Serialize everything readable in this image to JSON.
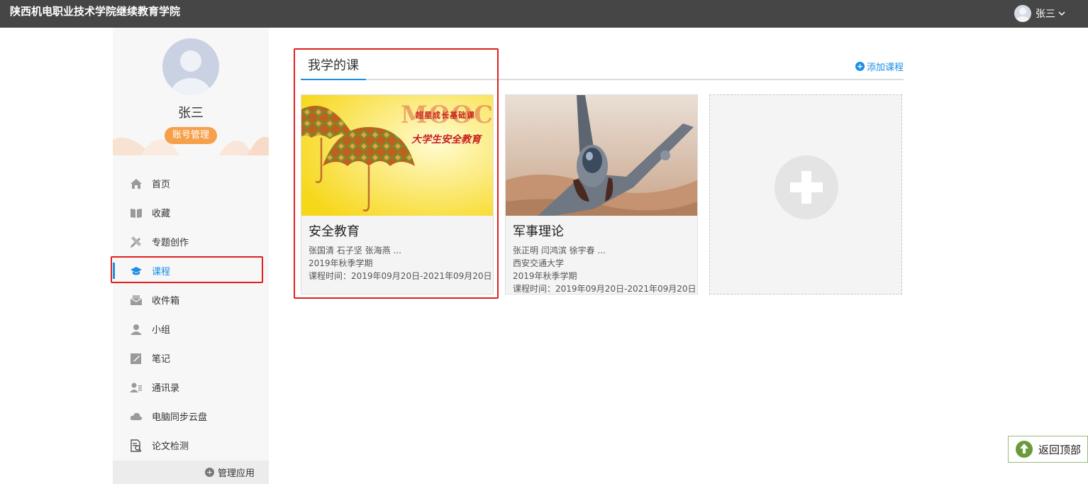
{
  "header": {
    "site_title": "陕西机电职业技术学院继续教育学院",
    "user_name": "张三"
  },
  "profile": {
    "name": "张三",
    "account_button": "账号管理"
  },
  "sidebar": {
    "items": [
      {
        "label": "首页",
        "icon": "home-icon"
      },
      {
        "label": "收藏",
        "icon": "book-icon"
      },
      {
        "label": "专题创作",
        "icon": "pencil-ruler-icon"
      },
      {
        "label": "课程",
        "icon": "graduation-cap-icon",
        "active": true
      },
      {
        "label": "收件箱",
        "icon": "inbox-icon"
      },
      {
        "label": "小组",
        "icon": "person-icon"
      },
      {
        "label": "笔记",
        "icon": "note-icon"
      },
      {
        "label": "通讯录",
        "icon": "contacts-icon"
      },
      {
        "label": "电脑同步云盘",
        "icon": "cloud-icon"
      },
      {
        "label": "论文检测",
        "icon": "document-check-icon"
      }
    ],
    "manage_apps": "管理应用"
  },
  "main": {
    "tab_label": "我学的课",
    "add_course": "添加课程",
    "courses": [
      {
        "title": "安全教育",
        "teachers": "张国清 石子坚 张海燕 ...",
        "school": "",
        "term": "2019年秋季学期",
        "period": "课程时间：2019年09月20日-2021年09月20日",
        "thumb_text_top": "超星成长基础课",
        "thumb_text_mooc": "MOOC",
        "thumb_text_bottom": "大学生安全教育"
      },
      {
        "title": "军事理论",
        "teachers": "张正明 闫鸿滨 徐宇春 ...",
        "school": "西安交通大学",
        "term": "2019年秋季学期",
        "period": "课程时间：2019年09月20日-2021年09月20日"
      }
    ]
  },
  "back_to_top": "返回顶部",
  "colors": {
    "topbar": "#464646",
    "accent": "#1a8ee6",
    "account_button": "#f5a04a",
    "highlight": "#e02020"
  }
}
